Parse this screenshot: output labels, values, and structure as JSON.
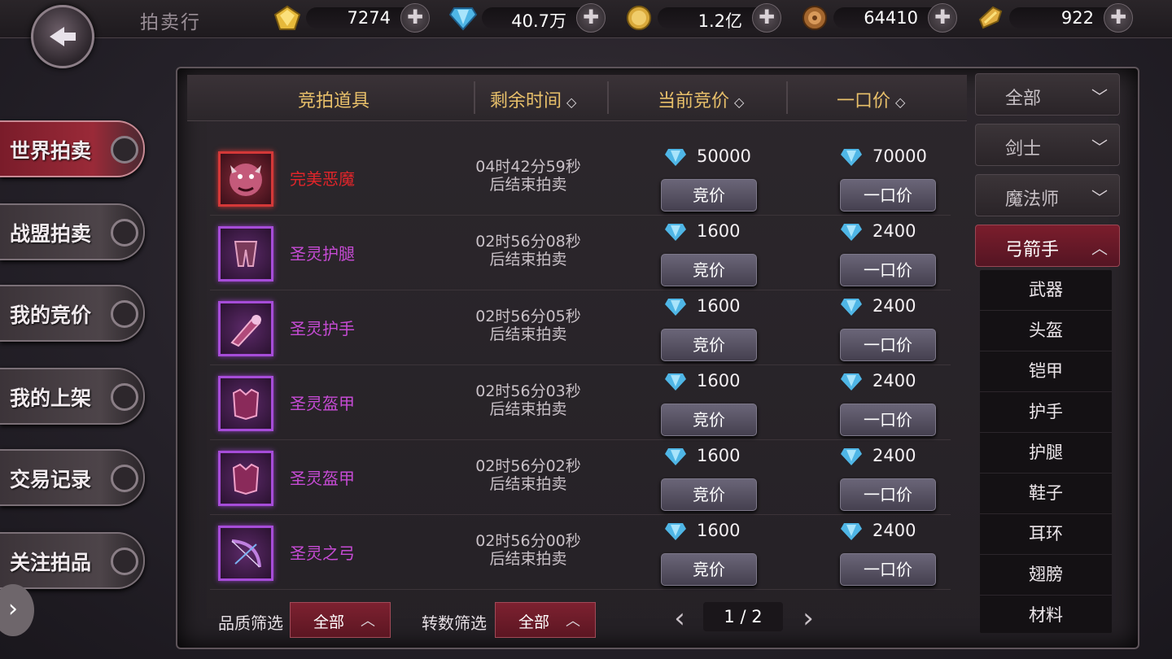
{
  "header": {
    "title": "拍卖行"
  },
  "currencies": [
    {
      "icon": "gold-gem-icon",
      "value": "7274"
    },
    {
      "icon": "blue-diamond-icon",
      "value": "40.7万"
    },
    {
      "icon": "gold-coin-icon",
      "value": "1.2亿"
    },
    {
      "icon": "bronze-medal-icon",
      "value": "64410"
    },
    {
      "icon": "gold-shard-icon",
      "value": "922"
    }
  ],
  "leftnav": [
    {
      "label": "世界拍卖",
      "active": true
    },
    {
      "label": "战盟拍卖"
    },
    {
      "label": "我的竞价"
    },
    {
      "label": "我的上架"
    },
    {
      "label": "交易记录"
    },
    {
      "label": "关注拍品"
    }
  ],
  "table": {
    "headers": {
      "item": "竞拍道具",
      "time": "剩余时间",
      "bid": "当前竞价",
      "buyout": "一口价"
    },
    "bid_button": "竞价",
    "buyout_button": "一口价",
    "rows": [
      {
        "name": "完美恶魔",
        "quality": "red",
        "time": "04时42分59秒",
        "time_suffix": "后结束拍卖",
        "bid": "50000",
        "buyout": "70000",
        "icon": "demon-icon"
      },
      {
        "name": "圣灵护腿",
        "quality": "purple",
        "time": "02时56分08秒",
        "time_suffix": "后结束拍卖",
        "bid": "1600",
        "buyout": "2400",
        "icon": "leggings-icon"
      },
      {
        "name": "圣灵护手",
        "quality": "purple",
        "time": "02时56分05秒",
        "time_suffix": "后结束拍卖",
        "bid": "1600",
        "buyout": "2400",
        "icon": "gauntlet-icon"
      },
      {
        "name": "圣灵盔甲",
        "quality": "purple",
        "time": "02时56分03秒",
        "time_suffix": "后结束拍卖",
        "bid": "1600",
        "buyout": "2400",
        "icon": "armor-icon"
      },
      {
        "name": "圣灵盔甲",
        "quality": "purple",
        "time": "02时56分02秒",
        "time_suffix": "后结束拍卖",
        "bid": "1600",
        "buyout": "2400",
        "icon": "armor-icon"
      },
      {
        "name": "圣灵之弓",
        "quality": "purple",
        "time": "02时56分00秒",
        "time_suffix": "后结束拍卖",
        "bid": "1600",
        "buyout": "2400",
        "icon": "bow-icon"
      }
    ]
  },
  "filters": [
    {
      "label": "全部",
      "expanded": false
    },
    {
      "label": "剑士",
      "expanded": false
    },
    {
      "label": "魔法师",
      "expanded": false
    },
    {
      "label": "弓箭手",
      "expanded": true
    }
  ],
  "submenu": [
    "武器",
    "头盔",
    "铠甲",
    "护手",
    "护腿",
    "鞋子",
    "耳环",
    "翅膀",
    "材料"
  ],
  "bottom": {
    "quality_label": "品质筛选",
    "quality_value": "全部",
    "rebirth_label": "转数筛选",
    "rebirth_value": "全部",
    "page": "1 / 2"
  },
  "colors": {
    "accent_red": "#7b1d2c",
    "purple_item": "#c64bd4",
    "red_item": "#e0252a",
    "header_gold": "#e8c06a"
  }
}
